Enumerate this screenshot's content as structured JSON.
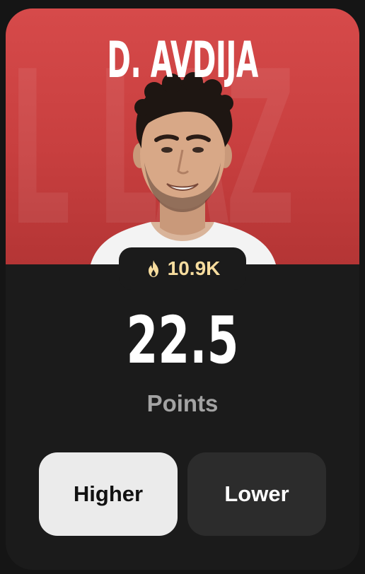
{
  "card": {
    "player_name": "D. AVDIJA",
    "background_watermark": "IL LAZ",
    "hero_color": "#d64a4a",
    "popularity": {
      "icon": "fire-icon",
      "value": "10.9K",
      "color": "#f6dc9e"
    },
    "stat": {
      "value": "22.5",
      "label": "Points"
    },
    "buttons": {
      "higher_label": "Higher",
      "lower_label": "Lower"
    }
  }
}
